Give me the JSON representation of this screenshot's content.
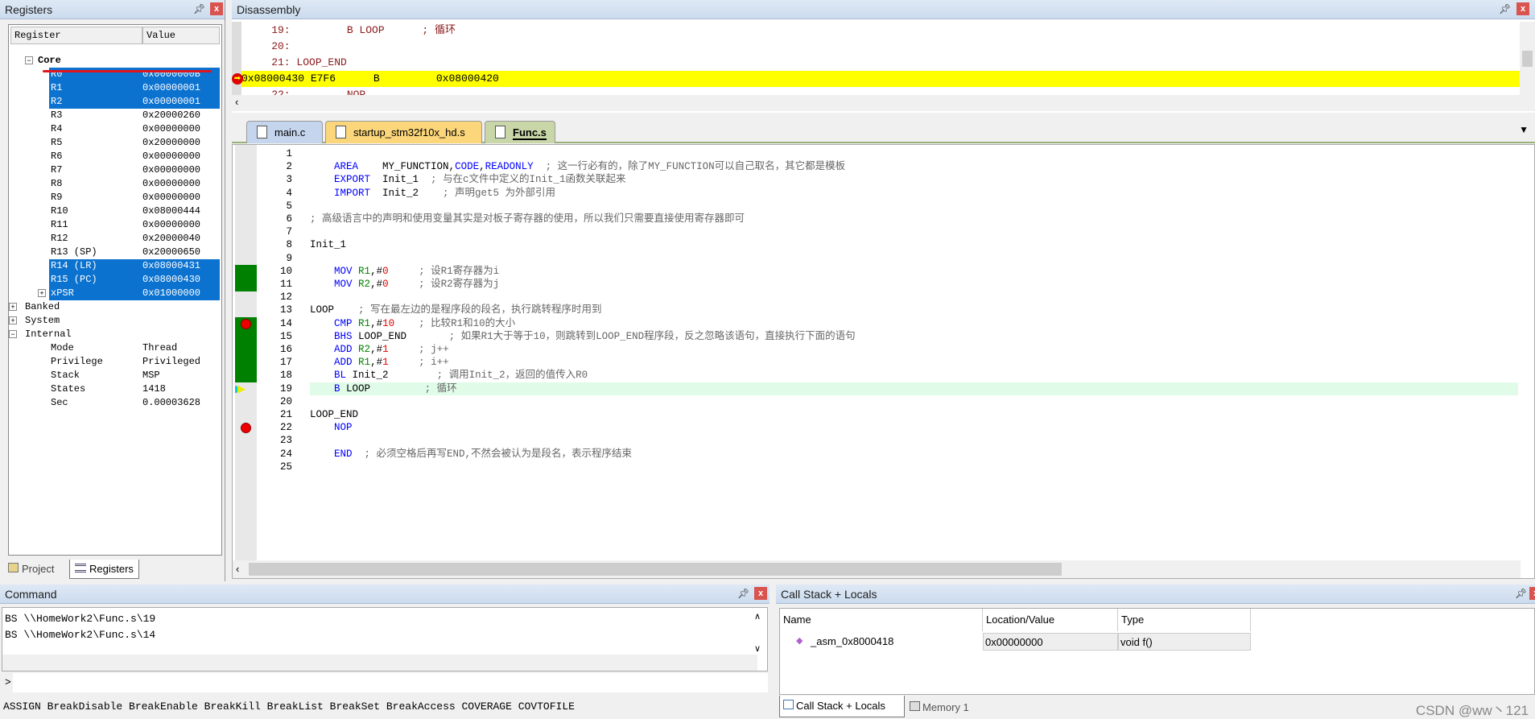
{
  "registers_panel": {
    "title": "Registers",
    "col_register": "Register",
    "col_value": "Value",
    "core_label": "Core",
    "core": [
      {
        "name": "R0",
        "value": "0x0000000B",
        "selected": true
      },
      {
        "name": "R1",
        "value": "0x00000001",
        "selected": true
      },
      {
        "name": "R2",
        "value": "0x00000001",
        "selected": true
      },
      {
        "name": "R3",
        "value": "0x20000260",
        "selected": false
      },
      {
        "name": "R4",
        "value": "0x00000000",
        "selected": false
      },
      {
        "name": "R5",
        "value": "0x20000000",
        "selected": false
      },
      {
        "name": "R6",
        "value": "0x00000000",
        "selected": false
      },
      {
        "name": "R7",
        "value": "0x00000000",
        "selected": false
      },
      {
        "name": "R8",
        "value": "0x00000000",
        "selected": false
      },
      {
        "name": "R9",
        "value": "0x00000000",
        "selected": false
      },
      {
        "name": "R10",
        "value": "0x08000444",
        "selected": false
      },
      {
        "name": "R11",
        "value": "0x00000000",
        "selected": false
      },
      {
        "name": "R12",
        "value": "0x20000040",
        "selected": false
      },
      {
        "name": "R13 (SP)",
        "value": "0x20000650",
        "selected": false
      },
      {
        "name": "R14 (LR)",
        "value": "0x08000431",
        "selected": true
      },
      {
        "name": "R15 (PC)",
        "value": "0x08000430",
        "selected": true
      },
      {
        "name": "xPSR",
        "value": "0x01000000",
        "selected": true
      }
    ],
    "groups": [
      "Banked",
      "System",
      "Internal"
    ],
    "internal": [
      {
        "name": "Mode",
        "value": "Thread"
      },
      {
        "name": "Privilege",
        "value": "Privileged"
      },
      {
        "name": "Stack",
        "value": "MSP"
      },
      {
        "name": "States",
        "value": "1418"
      },
      {
        "name": "Sec",
        "value": "0.00003628"
      }
    ],
    "tabs": [
      "Project",
      "Registers"
    ],
    "annotation_color": "#e0141e"
  },
  "disassembly": {
    "title": "Disassembly",
    "lines": [
      "    19:         B LOOP      ; 循环",
      "    20: ",
      "    21: LOOP_END",
      "0x08000430 E7F6      B         0x08000420",
      "    22:         NOP"
    ],
    "current_line_color": "#ffff00"
  },
  "editor": {
    "tabs": [
      "main.c",
      "startup_stm32f10x_hd.s",
      "Func.s"
    ],
    "active_tab": "Func.s",
    "lines": [
      [],
      [
        [
          "    "
        ],
        [
          "AREA",
          "kw"
        ],
        [
          "    MY_FUNCTION,"
        ],
        [
          "CODE",
          "kw"
        ],
        [
          ","
        ],
        [
          "READONLY",
          "kw"
        ],
        [
          "  ; 这一行必有的，除了MY_FUNCTION可以自己取名，其它都是模板",
          "cm"
        ]
      ],
      [
        [
          "    "
        ],
        [
          "EXPORT",
          "kw"
        ],
        [
          "  Init_1  "
        ],
        [
          "; 与在c文件中定义的Init_1函数关联起来",
          "cm"
        ]
      ],
      [
        [
          "    "
        ],
        [
          "IMPORT",
          "kw"
        ],
        [
          "  Init_2   "
        ],
        [
          " ; 声明get5 为外部引用",
          "cm"
        ]
      ],
      [],
      [
        [
          "; 高级语言中的声明和使用变量其实是对板子寄存器的使用，所以我们只需要直接使用寄存器即可",
          "cm"
        ]
      ],
      [],
      [
        [
          "Init_1"
        ]
      ],
      [],
      [
        [
          "    "
        ],
        [
          "MOV",
          "kw"
        ],
        [
          " "
        ],
        [
          "R1",
          "reg"
        ],
        [
          ",#"
        ],
        [
          "0",
          "num"
        ],
        [
          "     "
        ],
        [
          "; 设R1寄存器为i",
          "cm"
        ]
      ],
      [
        [
          "    "
        ],
        [
          "MOV",
          "kw"
        ],
        [
          " "
        ],
        [
          "R2",
          "reg"
        ],
        [
          ",#"
        ],
        [
          "0",
          "num"
        ],
        [
          "     "
        ],
        [
          "; 设R2寄存器为j",
          "cm"
        ]
      ],
      [],
      [
        [
          "LOOP    "
        ],
        [
          "; 写在最左边的是程序段的段名，执行跳转程序时用到",
          "cm"
        ]
      ],
      [
        [
          "    "
        ],
        [
          "CMP",
          "kw"
        ],
        [
          " "
        ],
        [
          "R1",
          "reg"
        ],
        [
          ",#"
        ],
        [
          "10",
          "num"
        ],
        [
          "    "
        ],
        [
          "; 比较R1和10的大小",
          "cm"
        ]
      ],
      [
        [
          "    "
        ],
        [
          "BHS",
          "kw"
        ],
        [
          " LOOP_END      "
        ],
        [
          " ; 如果R1大于等于10，则跳转到LOOP_END程序段，反之忽略该语句，直接执行下面的语句",
          "cm"
        ]
      ],
      [
        [
          "    "
        ],
        [
          "ADD",
          "kw"
        ],
        [
          " "
        ],
        [
          "R2",
          "reg"
        ],
        [
          ",#"
        ],
        [
          "1",
          "num"
        ],
        [
          "     "
        ],
        [
          "; j++",
          "cm"
        ]
      ],
      [
        [
          "    "
        ],
        [
          "ADD",
          "kw"
        ],
        [
          " "
        ],
        [
          "R1",
          "reg"
        ],
        [
          ",#"
        ],
        [
          "1",
          "num"
        ],
        [
          "     "
        ],
        [
          "; i++",
          "cm"
        ]
      ],
      [
        [
          "    "
        ],
        [
          "BL",
          "kw"
        ],
        [
          " Init_2        "
        ],
        [
          "; 调用Init_2，返回的值传入R0",
          "cm"
        ]
      ],
      [
        [
          "    "
        ],
        [
          "B",
          "kw"
        ],
        [
          " LOOP         "
        ],
        [
          "; 循环",
          "cm"
        ]
      ],
      [],
      [
        [
          "LOOP_END"
        ]
      ],
      [
        [
          "    "
        ],
        [
          "NOP",
          "kw"
        ]
      ],
      [],
      [
        [
          "    "
        ],
        [
          "END",
          "kw"
        ],
        [
          "  ; 必须空格后再写END,不然会被认为是段名，表示程序结束",
          "cm"
        ]
      ],
      []
    ],
    "breakpoints": [
      14,
      22
    ],
    "current_line": 19,
    "executed_lines": [
      10,
      11,
      14,
      15,
      16,
      17,
      18
    ],
    "executed_color": "#008000",
    "current_line_bg": "#e0fbe8"
  },
  "command": {
    "title": "Command",
    "output": [
      "BS \\\\HomeWork2\\Func.s\\19",
      "BS \\\\HomeWork2\\Func.s\\14"
    ],
    "prompt": ">",
    "hint": "ASSIGN BreakDisable BreakEnable BreakKill BreakList BreakSet BreakAccess COVERAGE COVTOFILE"
  },
  "callstack": {
    "title": "Call Stack + Locals",
    "columns": [
      "Name",
      "Location/Value",
      "Type"
    ],
    "rows": [
      {
        "name": "_asm_0x8000418",
        "value": "0x00000000",
        "type": "void f()"
      }
    ],
    "tabs": [
      "Call Stack + Locals",
      "Memory 1"
    ]
  },
  "watermark": "CSDN @ww丶121"
}
